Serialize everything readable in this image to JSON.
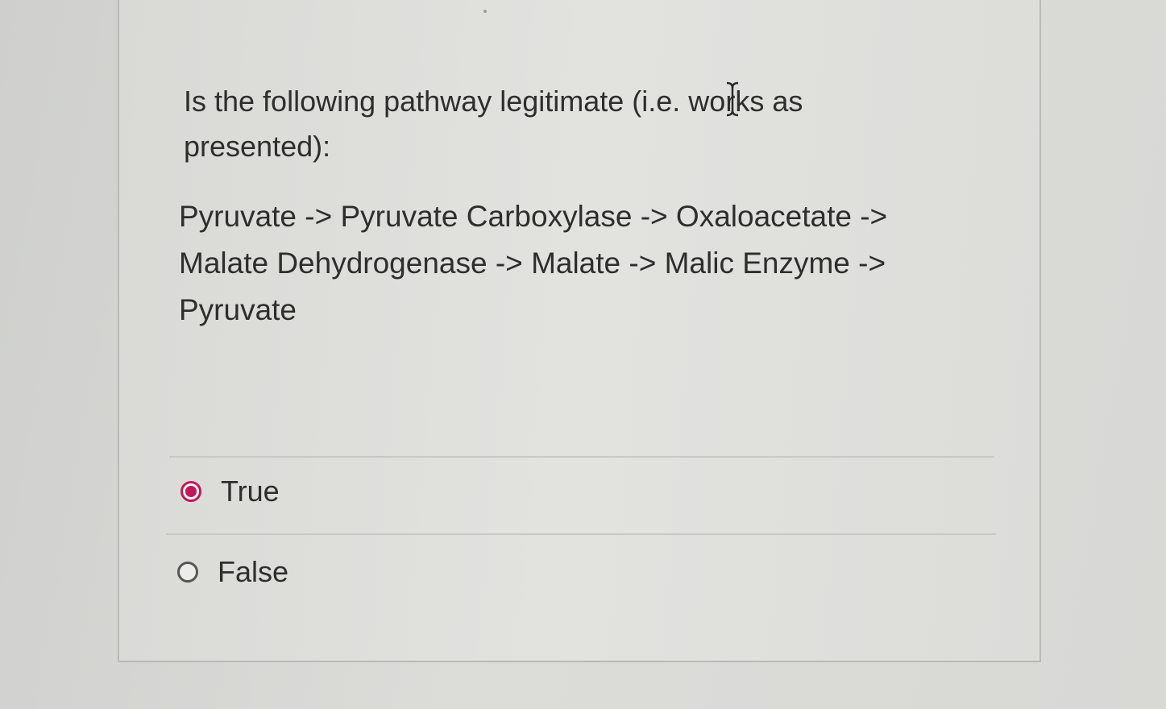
{
  "question": {
    "prompt_line1": "Is the following pathway legitimate (i.e. works as",
    "prompt_line2": "presented):"
  },
  "pathway": {
    "line1": "Pyruvate -> Pyruvate Carboxylase -> Oxaloacetate ->",
    "line2": "Malate Dehydrogenase -> Malate -> Malic Enzyme ->",
    "line3": "Pyruvate"
  },
  "options": [
    {
      "label": "True",
      "selected": true
    },
    {
      "label": "False",
      "selected": false
    }
  ],
  "colors": {
    "accent": "#c2185b",
    "text": "#2e2e2e"
  },
  "icons": {
    "cursor": "text-cursor-icon"
  }
}
